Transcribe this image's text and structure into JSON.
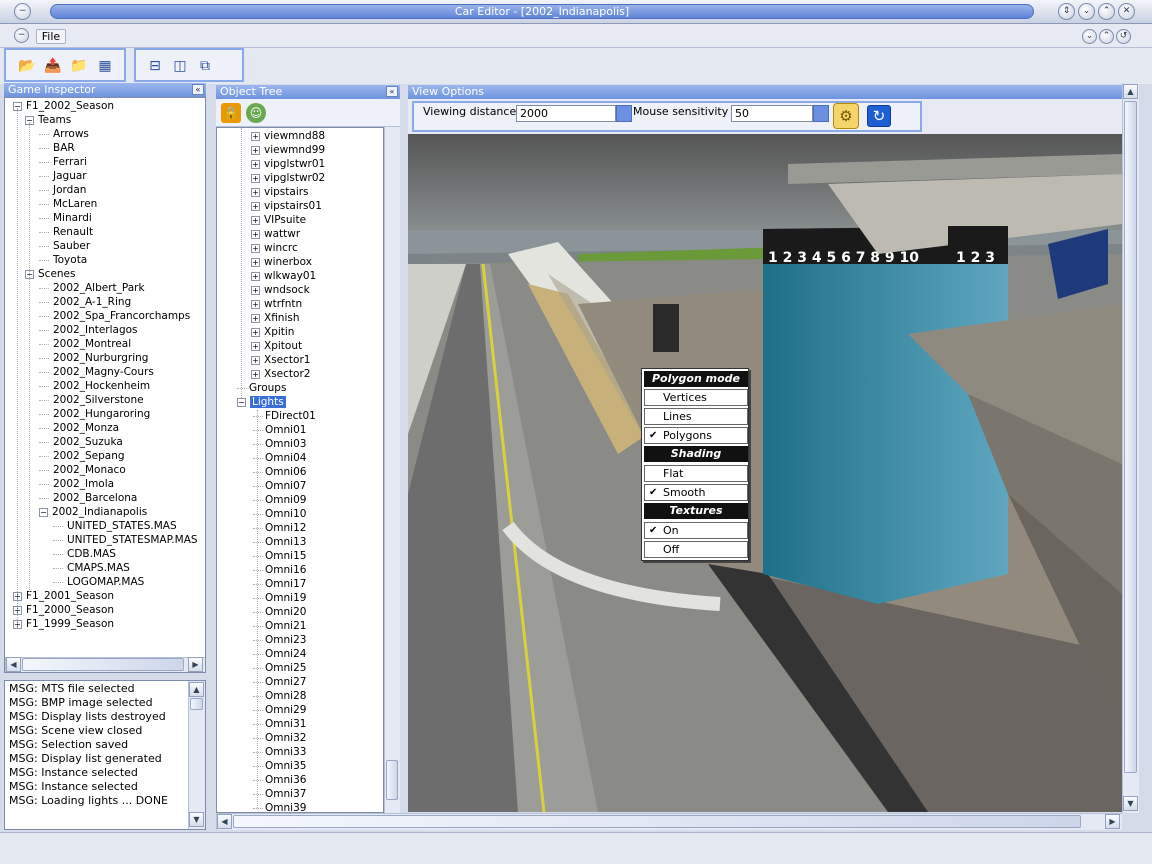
{
  "window": {
    "title": "Car Editor - [2002_Indianapolis]"
  },
  "menu": {
    "file_label": "File"
  },
  "game_inspector": {
    "header": "Game Inspector",
    "tree": [
      {
        "label": "F1_2002_Season",
        "level": 0,
        "expander": "−"
      },
      {
        "label": "Teams",
        "level": 1,
        "expander": "−"
      },
      {
        "label": "Arrows",
        "level": 2
      },
      {
        "label": "BAR",
        "level": 2
      },
      {
        "label": "Ferrari",
        "level": 2
      },
      {
        "label": "Jaguar",
        "level": 2
      },
      {
        "label": "Jordan",
        "level": 2
      },
      {
        "label": "McLaren",
        "level": 2
      },
      {
        "label": "Minardi",
        "level": 2
      },
      {
        "label": "Renault",
        "level": 2
      },
      {
        "label": "Sauber",
        "level": 2
      },
      {
        "label": "Toyota",
        "level": 2
      },
      {
        "label": "Scenes",
        "level": 1,
        "expander": "−"
      },
      {
        "label": "2002_Albert_Park",
        "level": 2
      },
      {
        "label": "2002_A-1_Ring",
        "level": 2
      },
      {
        "label": "2002_Spa_Francorchamps",
        "level": 2
      },
      {
        "label": "2002_Interlagos",
        "level": 2
      },
      {
        "label": "2002_Montreal",
        "level": 2
      },
      {
        "label": "2002_Nurburgring",
        "level": 2
      },
      {
        "label": "2002_Magny-Cours",
        "level": 2
      },
      {
        "label": "2002_Hockenheim",
        "level": 2
      },
      {
        "label": "2002_Silverstone",
        "level": 2
      },
      {
        "label": "2002_Hungaroring",
        "level": 2
      },
      {
        "label": "2002_Monza",
        "level": 2
      },
      {
        "label": "2002_Suzuka",
        "level": 2
      },
      {
        "label": "2002_Sepang",
        "level": 2
      },
      {
        "label": "2002_Monaco",
        "level": 2
      },
      {
        "label": "2002_Imola",
        "level": 2
      },
      {
        "label": "2002_Barcelona",
        "level": 2
      },
      {
        "label": "2002_Indianapolis",
        "level": 2,
        "expander": "−"
      },
      {
        "label": "UNITED_STATES.MAS",
        "level": 3
      },
      {
        "label": "UNITED_STATESMAP.MAS",
        "level": 3
      },
      {
        "label": "CDB.MAS",
        "level": 3
      },
      {
        "label": "CMAPS.MAS",
        "level": 3
      },
      {
        "label": "LOGOMAP.MAS",
        "level": 3
      },
      {
        "label": "F1_2001_Season",
        "level": 0,
        "expander": "+"
      },
      {
        "label": "F1_2000_Season",
        "level": 0,
        "expander": "+"
      },
      {
        "label": "F1_1999_Season",
        "level": 0,
        "expander": "+"
      }
    ]
  },
  "messages": [
    "MSG: MTS file selected",
    "MSG: BMP image selected",
    "MSG: Display lists destroyed",
    "MSG: Scene view closed",
    "MSG: Selection saved",
    "MSG: Display list generated",
    "MSG: Instance selected",
    "MSG: Instance selected",
    "MSG: Loading lights ... DONE"
  ],
  "object_tree": {
    "header": "Object Tree",
    "items": [
      {
        "label": "viewmnd88",
        "expander": "+"
      },
      {
        "label": "viewmnd99",
        "expander": "+"
      },
      {
        "label": "vipglstwr01",
        "expander": "+"
      },
      {
        "label": "vipglstwr02",
        "expander": "+"
      },
      {
        "label": "vipstairs",
        "expander": "+"
      },
      {
        "label": "vipstairs01",
        "expander": "+"
      },
      {
        "label": "VIPsuite",
        "expander": "+"
      },
      {
        "label": "wattwr",
        "expander": "+"
      },
      {
        "label": "wincrc",
        "expander": "+"
      },
      {
        "label": "winerbox",
        "expander": "+"
      },
      {
        "label": "wlkway01",
        "expander": "+"
      },
      {
        "label": "wndsock",
        "expander": "+"
      },
      {
        "label": "wtrfntn",
        "expander": "+"
      },
      {
        "label": "Xfinish",
        "expander": "+"
      },
      {
        "label": "Xpitin",
        "expander": "+"
      },
      {
        "label": "Xpitout",
        "expander": "+"
      },
      {
        "label": "Xsector1",
        "expander": "+"
      },
      {
        "label": "Xsector2",
        "expander": "+"
      },
      {
        "label": "Groups",
        "kind": "group"
      },
      {
        "label": "Lights",
        "kind": "lights",
        "expander": "−",
        "selected": true
      },
      {
        "label": "FDirect01",
        "kind": "light"
      },
      {
        "label": "Omni01",
        "kind": "light"
      },
      {
        "label": "Omni03",
        "kind": "light"
      },
      {
        "label": "Omni04",
        "kind": "light"
      },
      {
        "label": "Omni06",
        "kind": "light"
      },
      {
        "label": "Omni07",
        "kind": "light"
      },
      {
        "label": "Omni09",
        "kind": "light"
      },
      {
        "label": "Omni10",
        "kind": "light"
      },
      {
        "label": "Omni12",
        "kind": "light"
      },
      {
        "label": "Omni13",
        "kind": "light"
      },
      {
        "label": "Omni15",
        "kind": "light"
      },
      {
        "label": "Omni16",
        "kind": "light"
      },
      {
        "label": "Omni17",
        "kind": "light"
      },
      {
        "label": "Omni19",
        "kind": "light"
      },
      {
        "label": "Omni20",
        "kind": "light"
      },
      {
        "label": "Omni21",
        "kind": "light"
      },
      {
        "label": "Omni23",
        "kind": "light"
      },
      {
        "label": "Omni24",
        "kind": "light"
      },
      {
        "label": "Omni25",
        "kind": "light"
      },
      {
        "label": "Omni27",
        "kind": "light"
      },
      {
        "label": "Omni28",
        "kind": "light"
      },
      {
        "label": "Omni29",
        "kind": "light"
      },
      {
        "label": "Omni31",
        "kind": "light"
      },
      {
        "label": "Omni32",
        "kind": "light"
      },
      {
        "label": "Omni33",
        "kind": "light"
      },
      {
        "label": "Omni35",
        "kind": "light"
      },
      {
        "label": "Omni36",
        "kind": "light"
      },
      {
        "label": "Omni37",
        "kind": "light"
      },
      {
        "label": "Omni39",
        "kind": "light"
      }
    ]
  },
  "view_options": {
    "header": "View Options",
    "viewing_distance_label": "Viewing distance",
    "viewing_distance_value": "2000",
    "mouse_sensitivity_label": "Mouse sensitivity",
    "mouse_sensitivity_value": "50"
  },
  "scene": {
    "timing_left": "1 2 3 4 5 6 7 8 9 10",
    "timing_right": "1 2 3"
  },
  "context_menu": {
    "polygon_header": "Polygon mode",
    "vertices": "Vertices",
    "lines": "Lines",
    "polygons": "Polygons",
    "polygons_checked": true,
    "shading_header": "Shading",
    "flat": "Flat",
    "smooth": "Smooth",
    "smooth_checked": true,
    "textures_header": "Textures",
    "on": "On",
    "on_checked": true,
    "off": "Off"
  }
}
